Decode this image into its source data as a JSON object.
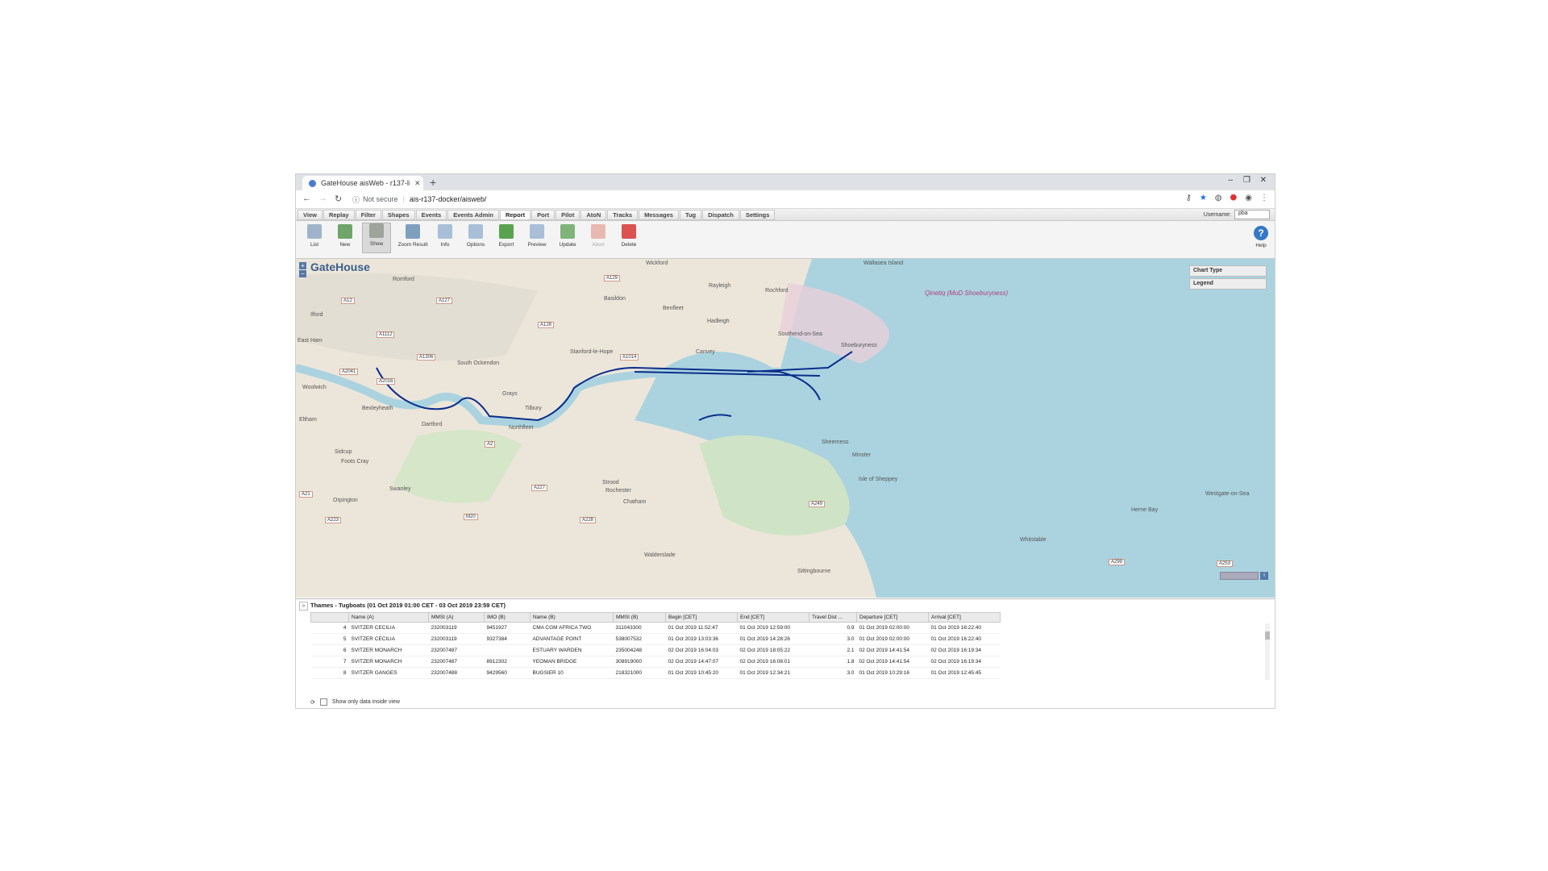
{
  "browser": {
    "tab_title": "GateHouse aisWeb - r137-linux",
    "not_secure": "Not secure",
    "url": "ais-r137-docker/aisweb/"
  },
  "menu": [
    "View",
    "Replay",
    "Filter",
    "Shapes",
    "Events",
    "Events Admin",
    "Report",
    "Port",
    "Pilot",
    "AtoN",
    "Tracks",
    "Messages",
    "Tug",
    "Dispatch",
    "Settings"
  ],
  "user": {
    "label": "Username:",
    "value": "pba"
  },
  "toolbar": {
    "list": "List",
    "new": "New",
    "show": "Show",
    "zoom_result": "Zoom Result",
    "info": "Info",
    "options": "Options",
    "export": "Export",
    "preview": "Preview",
    "update": "Update",
    "abort": "Abort",
    "delete": "Delete",
    "help": "Help"
  },
  "map": {
    "logo": "GateHouse",
    "chart_type": "Chart Type",
    "legend": "Legend",
    "places": {
      "wickford": "Wickford",
      "rayleigh": "Rayleigh",
      "rochford": "Rochford",
      "basildon": "Basildon",
      "benfleet": "Benfleet",
      "hadleigh": "Hadleigh",
      "southend": "Southend-on-Sea",
      "shoeburyness": "Shoeburyness",
      "romford": "Romford",
      "ilford": "Ilford",
      "east_ham": "East Ham",
      "woolwich": "Woolwich",
      "south_ockendon": "South Ockendon",
      "stanford": "Stanford-le-Hope",
      "canvey": "Canvey",
      "grays": "Grays",
      "tilbury": "Tilbury",
      "bexleyheath": "Bexleyheath",
      "dartford": "Dartford",
      "northfleet": "Northfleet",
      "eltham": "Eltham",
      "sidcup": "Sidcup",
      "foots_cray": "Foots Cray",
      "swanley": "Swanley",
      "orpington": "Orpington",
      "strood": "Strood",
      "rochester": "Rochester",
      "chatham": "Chatham",
      "walderslade": "Walderslade",
      "sheerness": "Sheerness",
      "minster": "Minster",
      "isle_of_sheppey": "Isle of Sheppey",
      "sittingbourne": "Sittingbourne",
      "whitstable": "Whitstable",
      "herne_bay": "Herne Bay",
      "westgate": "Westgate-on-Sea",
      "qinetiq": "Qinetiq (MoD Shoeburyness)",
      "wallasea": "Wallasea Island"
    },
    "roads": {
      "a12": "A12",
      "a127": "A127",
      "a129": "A129",
      "a1112": "A1112",
      "a128": "A128",
      "a1306": "A1306",
      "a1014": "A1014",
      "a2041": "A2041",
      "a2016": "A2016",
      "a2": "A2",
      "a227": "A227",
      "a228": "A228",
      "a249": "A249",
      "m20": "M20",
      "a21": "A21",
      "a223": "A223",
      "a299": "A299",
      "a253": "A253"
    }
  },
  "report": {
    "title": "Thames - Tugboats (01 Oct 2019 01:00 CET - 03 Oct 2019 23:59 CET)",
    "columns": [
      "",
      "Name (A)",
      "MMSI (A)",
      "IMO (B)",
      "Name (B)",
      "MMSI (B)",
      "Begin [CET]",
      "End [CET]",
      "Travel Dist ...",
      "Departure [CET]",
      "Arrival [CET]"
    ],
    "rows": [
      [
        "4",
        "SVITZER CECILIA",
        "232003119",
        "9451927",
        "CMA CGM AFRICA TWO",
        "311043300",
        "01 Oct 2019 11:52:47",
        "01 Oct 2019 12:59:00",
        "0.9",
        "01 Oct 2019 02:00:00",
        "01 Oct 2019 16:22:40"
      ],
      [
        "5",
        "SVITZER CECILIA",
        "232003119",
        "9327384",
        "ADVANTAGE POINT",
        "538007532",
        "01 Oct 2019 13:03:36",
        "01 Oct 2019 14:28:26",
        "3.0",
        "01 Oct 2019 02:00:00",
        "01 Oct 2019 16:22:40"
      ],
      [
        "6",
        "SVITZER MONARCH",
        "232007487",
        "",
        "ESTUARY WARDEN",
        "235004248",
        "02 Oct 2019 16:04:03",
        "02 Oct 2019 18:05:22",
        "2.1",
        "02 Oct 2019 14:41:54",
        "02 Oct 2019 16:19:34"
      ],
      [
        "7",
        "SVITZER MONARCH",
        "232007487",
        "8912302",
        "YEOMAN BRIDGE",
        "308919000",
        "02 Oct 2019 14:47:07",
        "02 Oct 2019 16:08:01",
        "1.8",
        "02 Oct 2019 14:41:54",
        "02 Oct 2019 16:19:34"
      ],
      [
        "8",
        "SVITZER GANGES",
        "232007488",
        "9429560",
        "BUGSIER 10",
        "218321000",
        "01 Oct 2019 10:45:20",
        "01 Oct 2019 12:34:21",
        "3.0",
        "01 Oct 2019 10:29:16",
        "01 Oct 2019 12:45:45"
      ]
    ],
    "footer_checkbox": "Show only data inside view"
  }
}
